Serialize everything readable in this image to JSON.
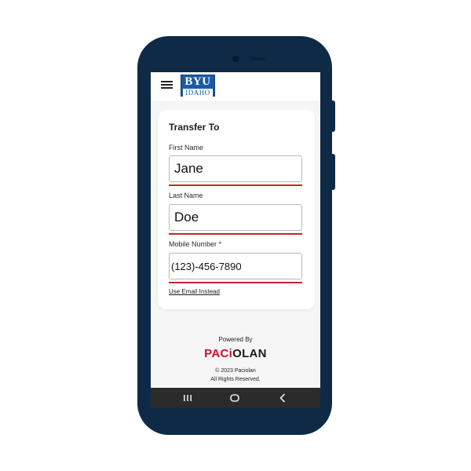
{
  "header": {
    "logo_top": "BYU",
    "logo_bottom": "IDAHO"
  },
  "form": {
    "title": "Transfer To",
    "first_name": {
      "label": "First Name",
      "value": "Jane"
    },
    "last_name": {
      "label": "Last Name",
      "value": "Doe"
    },
    "mobile": {
      "label": "Mobile Number *",
      "value": "(123)-456-7890"
    },
    "email_link": "Use Email Instead"
  },
  "footer": {
    "powered_by": "Powered By",
    "brand_red": "PACi",
    "brand_dark": "OLAN",
    "copyright": "© 2023 Paciolan",
    "rights": "All Rights Reserved."
  },
  "colors": {
    "phone_body": "#0e2a47",
    "accent_red": "#c0272d",
    "logo_blue": "#1a5aa6",
    "nav_bar": "#2b2b2b"
  },
  "icons": {
    "menu": "hamburger-menu-icon",
    "recents": "recents-icon",
    "home": "home-icon",
    "back": "back-icon"
  }
}
